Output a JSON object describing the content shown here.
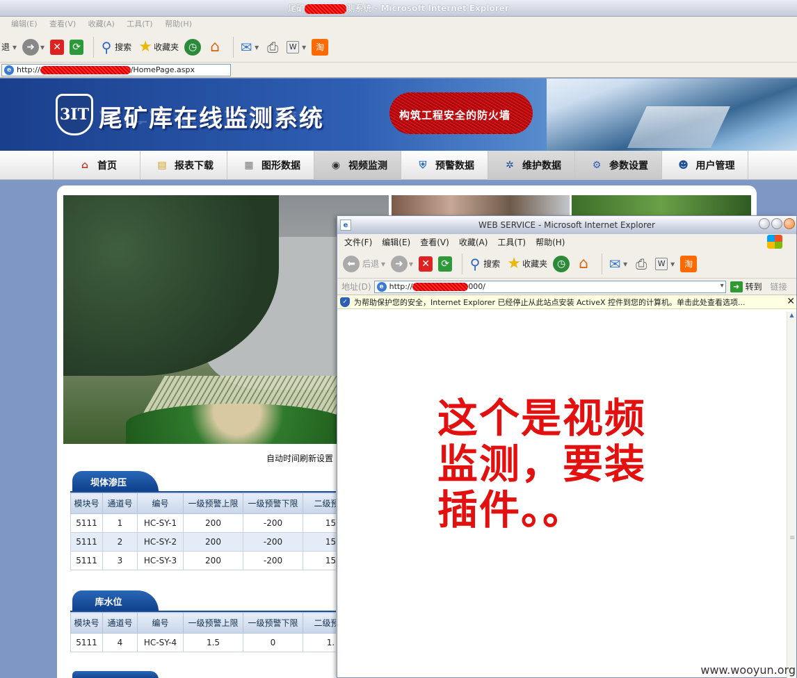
{
  "browser": {
    "title_prefix": "尾矿",
    "title_suffix": "测系统 - Microsoft Internet Explorer",
    "menu": [
      "编辑(E)",
      "查看(V)",
      "收藏(A)",
      "工具(T)",
      "帮助(H)"
    ],
    "toolbar": {
      "back": "退",
      "search": "搜索",
      "favorites": "收藏夹"
    },
    "address_prefix": "http://",
    "address_suffix": "/HomePage.aspx"
  },
  "banner": {
    "logo_text": "3IT",
    "title": "尾矿库在线监测系统",
    "slogan": "构筑工程安全的防火墙"
  },
  "nav": [
    {
      "label": "首页",
      "icon": "home-icon",
      "glyph": "⌂",
      "color": "#c0392b"
    },
    {
      "label": "报表下载",
      "icon": "report-icon",
      "glyph": "▤",
      "color": "#d4a017"
    },
    {
      "label": "图形数据",
      "icon": "chart-icon",
      "glyph": "▦",
      "color": "#7a7a7a"
    },
    {
      "label": "视频监测",
      "icon": "camera-icon",
      "glyph": "◉",
      "color": "#333333"
    },
    {
      "label": "预警数据",
      "icon": "shield-icon",
      "glyph": "⛨",
      "color": "#2a6fb8"
    },
    {
      "label": "维护数据",
      "icon": "gear-icon",
      "glyph": "✲",
      "color": "#1d4f96"
    },
    {
      "label": "参数设置",
      "icon": "settings-icon",
      "glyph": "⚙",
      "color": "#2b5fb3"
    },
    {
      "label": "用户管理",
      "icon": "user-icon",
      "glyph": "☻",
      "color": "#1d4f96"
    }
  ],
  "main": {
    "refresh_label": "自动时间刷新设置",
    "sections": [
      {
        "title": "坝体渗压",
        "headers": [
          "模块号",
          "通道号",
          "编号",
          "一级预警上限",
          "一级预警下限",
          "二级预警"
        ],
        "rows": [
          [
            "5111",
            "1",
            "HC-SY-1",
            "200",
            "-200",
            "15"
          ],
          [
            "5111",
            "2",
            "HC-SY-2",
            "200",
            "-200",
            "15"
          ],
          [
            "5111",
            "3",
            "HC-SY-3",
            "200",
            "-200",
            "15"
          ]
        ]
      },
      {
        "title": "库水位",
        "headers": [
          "模块号",
          "通道号",
          "编号",
          "一级预警上限",
          "一级预警下限",
          "二级预警"
        ],
        "rows": [
          [
            "5111",
            "4",
            "HC-SY-4",
            "1.5",
            "0",
            "1."
          ]
        ]
      }
    ]
  },
  "popup": {
    "title": "WEB SERVICE - Microsoft Internet Explorer",
    "menu": [
      "文件(F)",
      "编辑(E)",
      "查看(V)",
      "收藏(A)",
      "工具(T)",
      "帮助(H)"
    ],
    "toolbar": {
      "back": "后退",
      "search": "搜索",
      "favorites": "收藏夹"
    },
    "address_label": "地址(D)",
    "address_prefix": "http://",
    "address_suffix": "000/",
    "go_label": "转到",
    "links_label": "链接",
    "infobar": "为帮助保护您的安全，Internet Explorer 已经停止从此站点安装 ActiveX 控件到您的计算机。单击此处查看选项...",
    "annotation": "这个是视频监测，要装插件。。"
  },
  "watermark": "www.wooyun.org"
}
